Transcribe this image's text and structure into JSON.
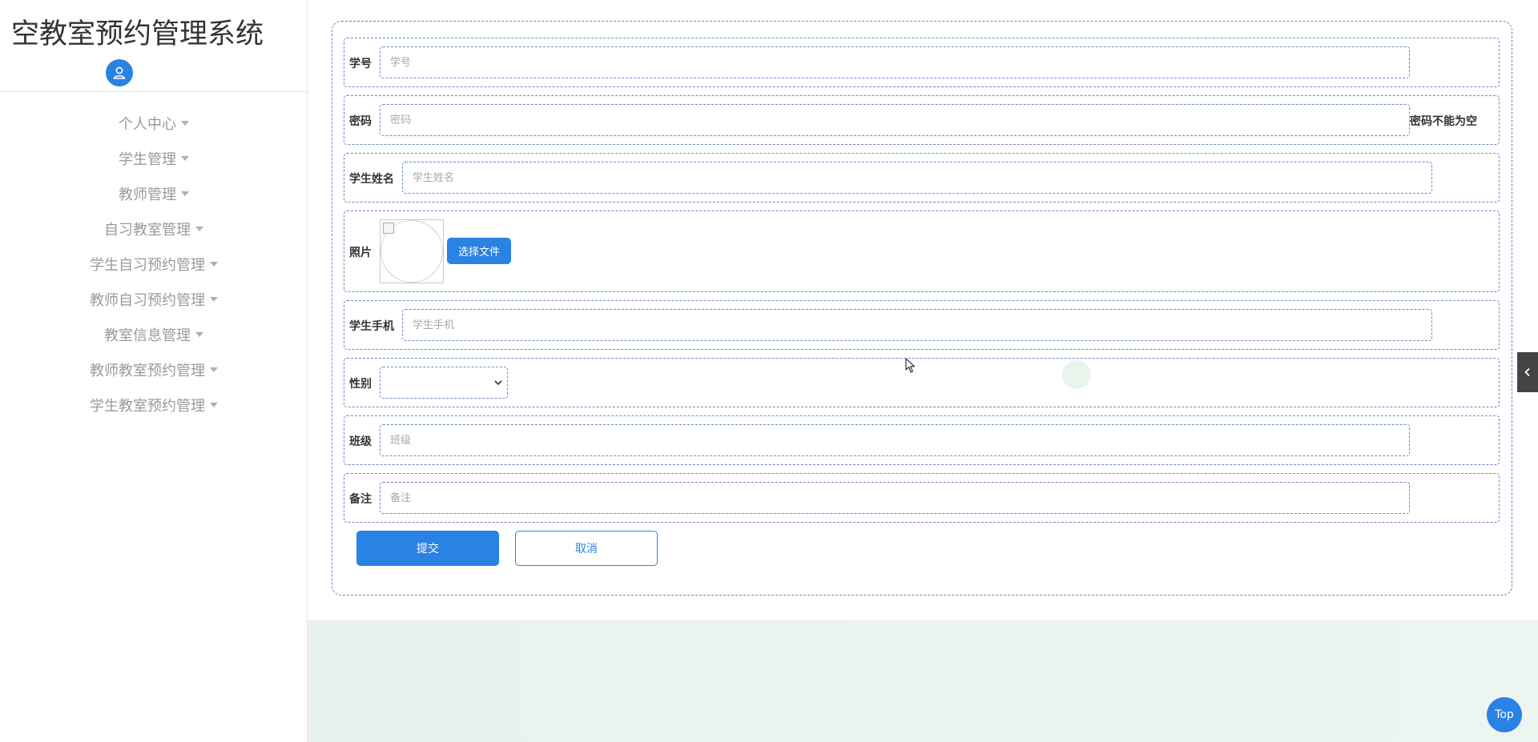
{
  "app": {
    "title": "空教室预约管理系统"
  },
  "sidebar": {
    "items": [
      {
        "label": "个人中心"
      },
      {
        "label": "学生管理"
      },
      {
        "label": "教师管理"
      },
      {
        "label": "自习教室管理"
      },
      {
        "label": "学生自习预约管理"
      },
      {
        "label": "教师自习预约管理"
      },
      {
        "label": "教室信息管理"
      },
      {
        "label": "教师教室预约管理"
      },
      {
        "label": "学生教室预约管理"
      }
    ]
  },
  "form": {
    "student_id": {
      "label": "学号",
      "placeholder": "学号",
      "value": ""
    },
    "password": {
      "label": "密码",
      "placeholder": "密码",
      "value": "",
      "error": "密码不能为空"
    },
    "student_name": {
      "label": "学生姓名",
      "placeholder": "学生姓名",
      "value": ""
    },
    "photo": {
      "label": "照片",
      "button_label": "选择文件"
    },
    "student_phone": {
      "label": "学生手机",
      "placeholder": "学生手机",
      "value": ""
    },
    "gender": {
      "label": "性别",
      "value": ""
    },
    "class": {
      "label": "班级",
      "placeholder": "班级",
      "value": ""
    },
    "remark": {
      "label": "备注",
      "placeholder": "备注",
      "value": ""
    },
    "submit_label": "提交",
    "cancel_label": "取消"
  },
  "floating": {
    "top_label": "Top"
  },
  "colors": {
    "accent": "#2a82e4",
    "border_dashed": "#6a86c8",
    "menu_text": "#9a9a9a"
  },
  "icons": {
    "avatar": "user-icon",
    "side_toggle": "chevron-left-icon",
    "select": "chevron-down-icon"
  }
}
